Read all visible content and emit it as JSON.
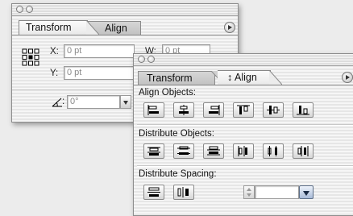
{
  "transform_palette": {
    "tabs": [
      {
        "label": "Transform",
        "active": true
      },
      {
        "label": "Align",
        "active": false
      }
    ],
    "fields": {
      "x_label": "X:",
      "x_value": "0 pt",
      "y_label": "Y:",
      "y_value": "0 pt",
      "w_label": "W:",
      "w_value": "0 pt",
      "angle_value": "0°"
    }
  },
  "align_palette": {
    "tabs": [
      {
        "label": "Transform",
        "active": false
      },
      {
        "label": "↕ Align",
        "active": true
      }
    ],
    "sections": {
      "align_objects": "Align Objects:",
      "distribute_objects": "Distribute Objects:",
      "distribute_spacing": "Distribute Spacing:"
    },
    "align_object_icons": [
      "horizontal-align-left-icon",
      "horizontal-align-center-icon",
      "horizontal-align-right-icon",
      "vertical-align-top-icon",
      "vertical-align-center-icon",
      "vertical-align-bottom-icon"
    ],
    "distribute_object_icons": [
      "vertical-distribute-top-icon",
      "vertical-distribute-center-icon",
      "vertical-distribute-bottom-icon",
      "horizontal-distribute-left-icon",
      "horizontal-distribute-center-icon",
      "horizontal-distribute-right-icon"
    ],
    "distribute_spacing_icons": [
      "vertical-distribute-space-icon",
      "horizontal-distribute-space-icon"
    ],
    "spacing_value": ""
  }
}
